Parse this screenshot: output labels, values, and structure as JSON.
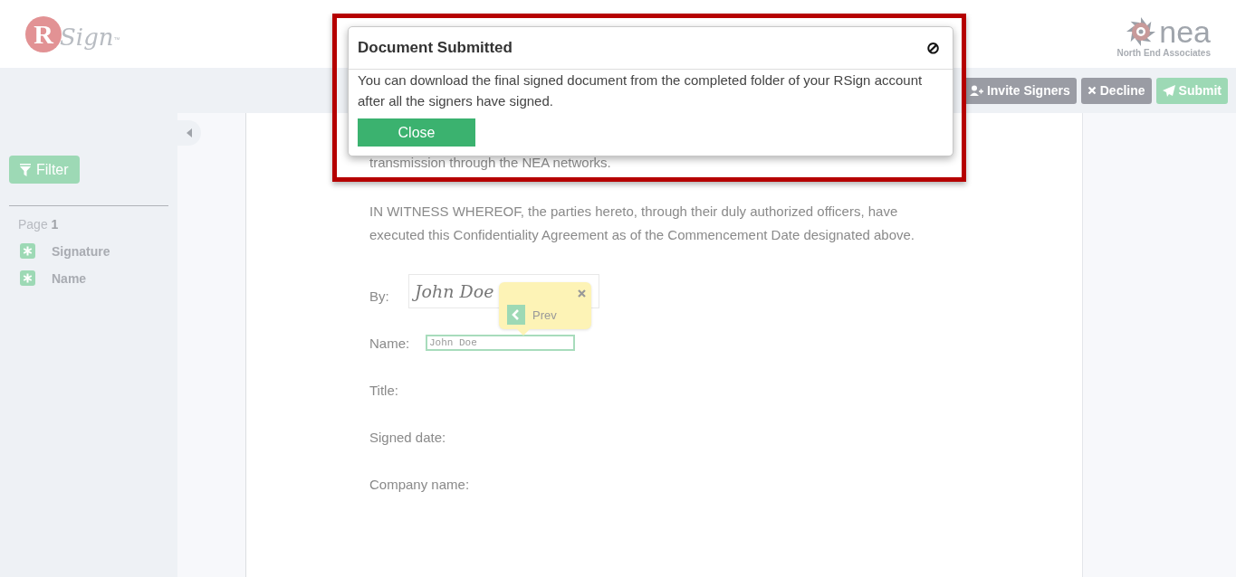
{
  "header": {
    "logo": {
      "letter": "R",
      "word": "Sign",
      "mark": "™"
    },
    "company_logo": {
      "word": "nea",
      "name": "North End Associates"
    }
  },
  "toolbar": {
    "buttons": [
      {
        "label": "Invite Signers",
        "kind": "invite"
      },
      {
        "label": "Decline",
        "kind": "decline"
      },
      {
        "label": "Submit",
        "kind": "submit"
      }
    ]
  },
  "sidebar": {
    "filter": "Filter",
    "page_label": "Page",
    "page_number": "1",
    "fields": [
      {
        "label": "Signature"
      },
      {
        "label": "Name"
      }
    ]
  },
  "document": {
    "paragraphs": [
      "transmission through the NEA networks.",
      "IN WITNESS WHEREOF, the parties hereto, through their duly authorized officers, have executed this Confidentiality Agreement as of the Commencement Date designated above."
    ],
    "fields": [
      {
        "label": "By:",
        "kind": "signature",
        "value": "John Doe"
      },
      {
        "label": "Name:",
        "kind": "text",
        "value": "John Doe"
      },
      {
        "label": "Title:",
        "kind": "blank"
      },
      {
        "label": "Signed date:",
        "kind": "blank"
      },
      {
        "label": "Company name:",
        "kind": "blank"
      }
    ],
    "tooltip": {
      "label": "Prev"
    }
  },
  "modal": {
    "title": "Document Submitted",
    "close_icon": "⊘",
    "message": "You can download the final signed document from the completed folder of your RSign account after all the signers have signed.",
    "button": "Close"
  }
}
